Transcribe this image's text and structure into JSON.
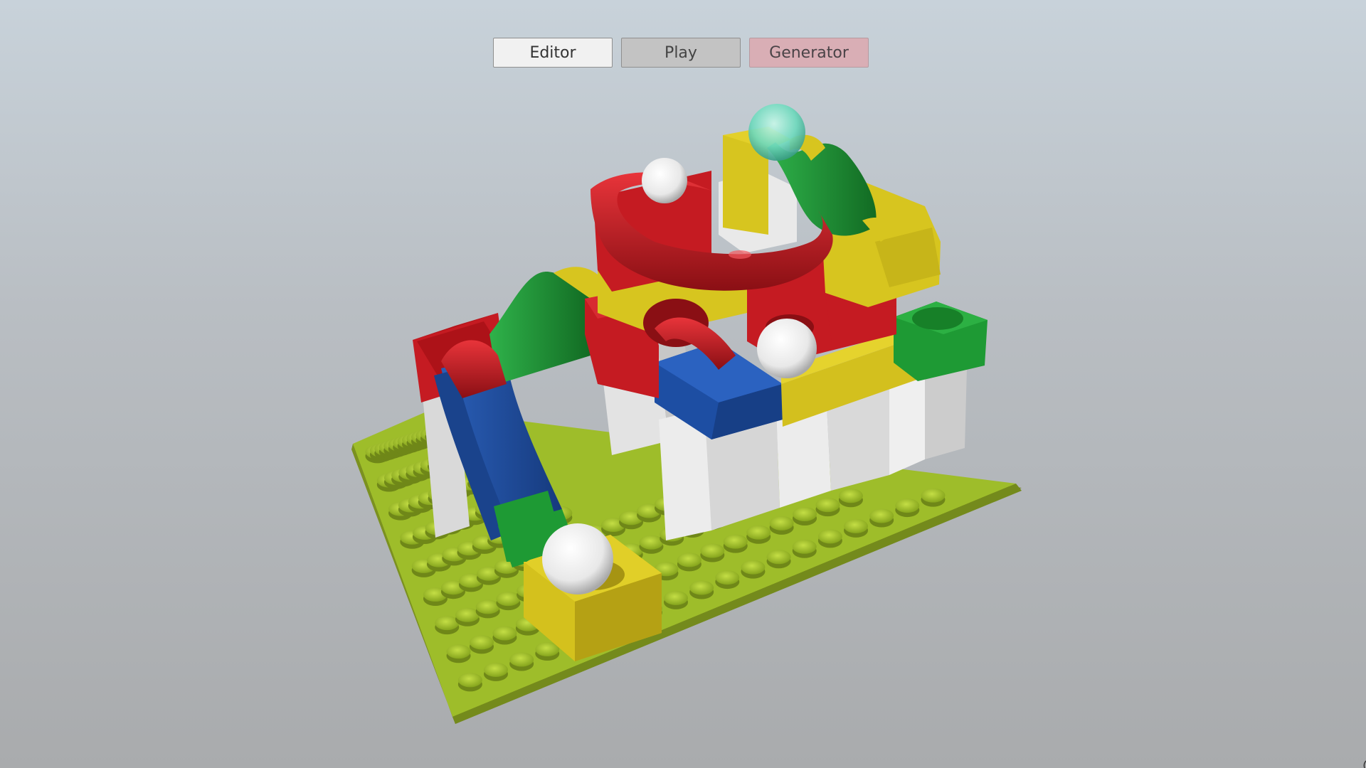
{
  "toolbar": {
    "buttons": [
      {
        "label": "Editor",
        "state": "active"
      },
      {
        "label": "Play",
        "state": "inactive"
      },
      {
        "label": "Generator",
        "state": "inactive"
      }
    ]
  },
  "scene": {
    "description_colors": {
      "baseplate": "#9ebd2a",
      "red": "#c8161e",
      "yellow": "#d7c51f",
      "green": "#1e9a34",
      "blue": "#1d4ea3",
      "white_block": "#e9e9e9",
      "ball_white": "#f4f4f4",
      "ball_teal": "#6fd9bd"
    }
  }
}
